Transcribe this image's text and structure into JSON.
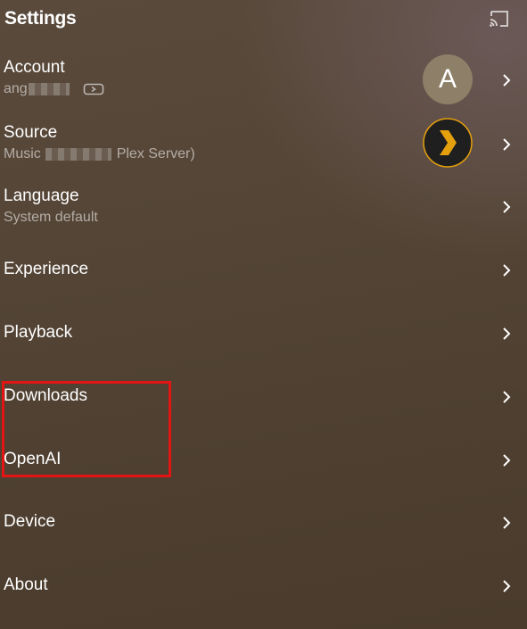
{
  "header": {
    "title": "Settings",
    "cast_icon": "cast-icon"
  },
  "rows": {
    "account": {
      "label": "Account",
      "sub_prefix": "ang",
      "avatar_letter": "A",
      "tag_icon": "switch-user-icon"
    },
    "source": {
      "label": "Source",
      "sub_prefix": "Music",
      "sub_suffix": "Plex Server)",
      "logo_icon": "plex-logo-icon"
    },
    "language": {
      "label": "Language",
      "sub": "System default"
    },
    "experience": {
      "label": "Experience"
    },
    "playback": {
      "label": "Playback"
    },
    "downloads": {
      "label": "Downloads"
    },
    "openai": {
      "label": "OpenAI"
    },
    "device": {
      "label": "Device"
    },
    "about": {
      "label": "About"
    }
  },
  "colors": {
    "highlight_border": "#e41414",
    "plex_chevron": "#e5a00d",
    "avatar_bg": "#8e8068"
  }
}
